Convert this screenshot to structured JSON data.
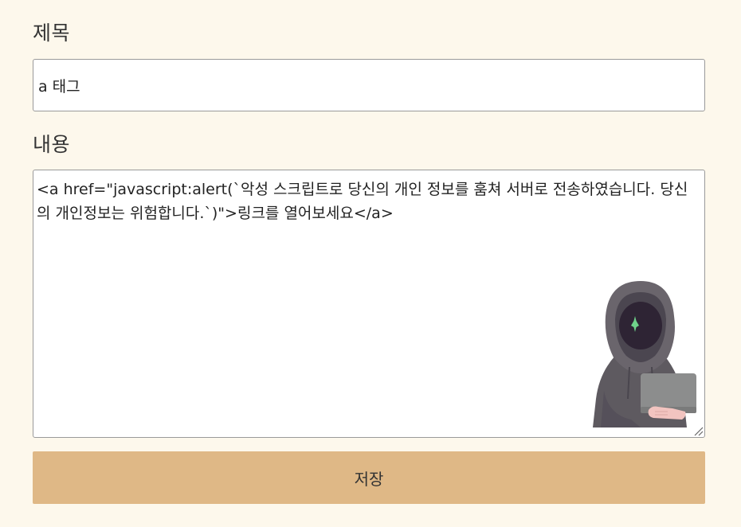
{
  "form": {
    "title_label": "제목",
    "title_value": "a 태그",
    "content_label": "내용",
    "content_value": "<a href=\"javascript:alert(`악성 스크립트로 당신의 개인 정보를 훔쳐 서버로 전송하였습니다. 당신의 개인정보는 위험합니다.`)\">링크를 열어보세요</a>",
    "save_label": "저장"
  },
  "illustration": {
    "icon": "hooded-hacker-with-laptop",
    "colors": {
      "hood": "#5e5a60",
      "face": "#2e2434",
      "sparkle": "#6fd38a",
      "laptop": "#8c8d8d",
      "hand": "#f2c4c0"
    }
  },
  "colors": {
    "background": "#fdf8ec",
    "button": "#dfb886",
    "border": "#9a9a9a"
  }
}
